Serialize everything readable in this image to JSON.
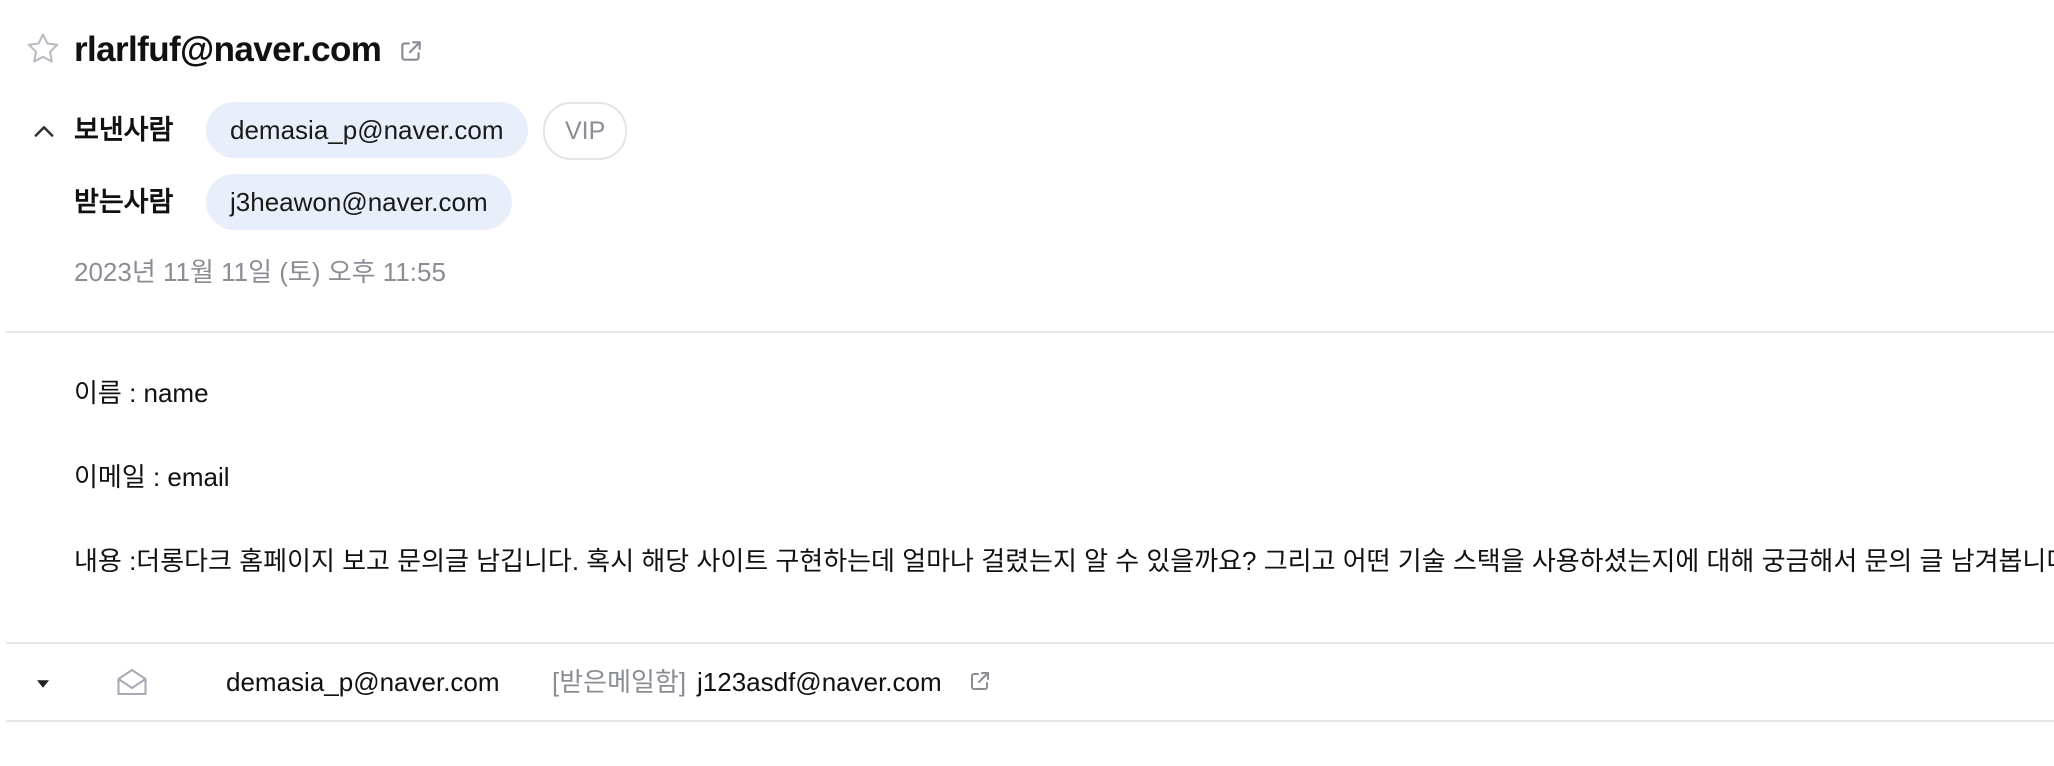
{
  "mail": {
    "subject": "rlarlfuf@naver.com",
    "sender_label": "보낸사람",
    "sender": "demasia_p@naver.com",
    "vip_label": "VIP",
    "recipient_label": "받는사람",
    "recipient": "j3heawon@naver.com",
    "date": "2023년 11월 11일 (토) 오후 11:55",
    "body": [
      "이름 : name",
      "이메일 : email",
      "내용 :더롱다크 홈페이지 보고 문의글 남깁니다. 혹시 해당 사이트 구현하는데 얼마나 걸렸는지 알 수 있을까요? 그리고 어떤 기술 스택을 사용하셨는지에 대해 궁금해서 문의 글 남겨봅니다."
    ]
  },
  "thread": {
    "sender": "demasia_p@naver.com",
    "folder": "[받은메일함]",
    "subject": "j123asdf@naver.com"
  },
  "icons": {
    "star": "star-outline-icon",
    "external": "external-link-icon",
    "collapse": "chevron-up-icon",
    "expand": "caret-down-icon",
    "envelope": "envelope-open-icon"
  }
}
